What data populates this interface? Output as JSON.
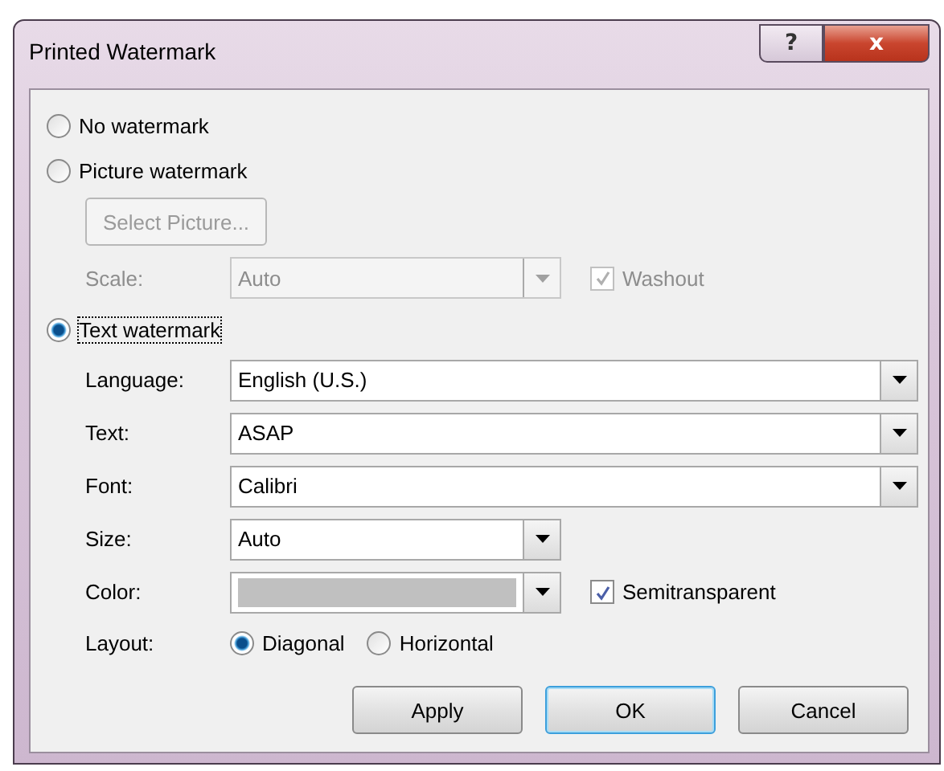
{
  "window": {
    "title": "Printed Watermark",
    "help_button": "?",
    "close_button": "x"
  },
  "options": [
    {
      "label": "No watermark",
      "selected": false
    },
    {
      "label": "Picture watermark",
      "selected": false
    }
  ],
  "picture": {
    "disabled": true,
    "select_button": "Select Picture...",
    "scale_label": "Scale:",
    "scale_value": "Auto",
    "washout": {
      "label": "Washout",
      "checked": true
    }
  },
  "text_option": {
    "label": "Text watermark",
    "selected": true
  },
  "fields": [
    {
      "kind": "wide",
      "label": "Language:",
      "value": "English (U.S.)"
    },
    {
      "kind": "wide",
      "label": "Text:",
      "value": "ASAP"
    },
    {
      "kind": "wide",
      "label": "Font:",
      "value": "Calibri"
    },
    {
      "kind": "narrow",
      "label": "Size:",
      "value": "Auto"
    },
    {
      "kind": "color",
      "label": "Color:",
      "color": "#c0c0c0",
      "checkbox": {
        "label": "Semitransparent",
        "checked": true
      }
    }
  ],
  "layout": {
    "label": "Layout:",
    "choices": [
      {
        "label": "Diagonal",
        "selected": true
      },
      {
        "label": "Horizontal",
        "selected": false
      }
    ]
  },
  "buttons": [
    {
      "label": "Apply",
      "default": false
    },
    {
      "label": "OK",
      "default": true
    },
    {
      "label": "Cancel",
      "default": false
    }
  ]
}
